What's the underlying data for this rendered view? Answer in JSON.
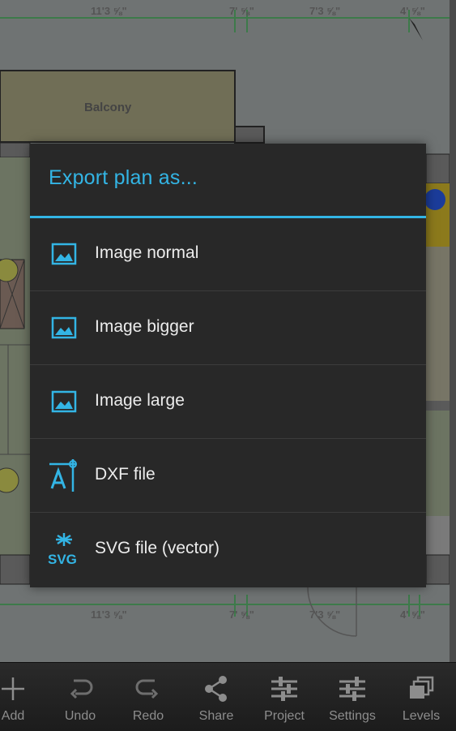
{
  "plan": {
    "balcony_label": "Balcony",
    "dims_top": [
      "11'3 ⅝\"",
      "7' ⅝\"",
      "7'3 ⅝\"",
      "4' ⅝\""
    ],
    "dims_bottom": [
      "11'3 ⅝\"",
      "7' ⅝\"",
      "7'3 ⅝\"",
      "4' ⅝\""
    ]
  },
  "dialog": {
    "title": "Export plan as...",
    "items": [
      {
        "label": "Image normal",
        "icon": "image-icon"
      },
      {
        "label": "Image bigger",
        "icon": "image-icon"
      },
      {
        "label": "Image large",
        "icon": "image-icon"
      },
      {
        "label": "DXF file",
        "icon": "dxf-icon"
      },
      {
        "label": "SVG file (vector)",
        "icon": "svg-icon"
      }
    ],
    "accent_color": "#33b5e5"
  },
  "toolbar": {
    "items": [
      {
        "label": "Add",
        "icon": "plus-icon"
      },
      {
        "label": "Undo",
        "icon": "undo-icon"
      },
      {
        "label": "Redo",
        "icon": "redo-icon"
      },
      {
        "label": "Share",
        "icon": "share-icon"
      },
      {
        "label": "Project",
        "icon": "sliders-icon"
      },
      {
        "label": "Settings",
        "icon": "sliders-icon"
      },
      {
        "label": "Levels",
        "icon": "layers-icon"
      }
    ]
  }
}
